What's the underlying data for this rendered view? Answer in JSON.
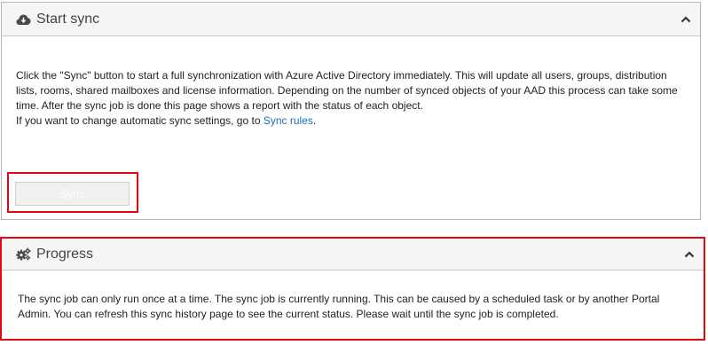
{
  "sync_panel": {
    "title": "Start sync",
    "icon": "cloud-download-icon",
    "paragraph_main": "Click the \"Sync\" button to start a full synchronization with Azure Active Directory immediately. This will update all users, groups, distribution lists, rooms, shared mailboxes and license information. Depending on the number of synced objects of your AAD this process can take some time. After the sync job is done this page shows a report with the status of each object.",
    "paragraph_settings_prefix": "If you want to change automatic sync settings, go to ",
    "sync_rules_link": "Sync rules",
    "paragraph_settings_suffix": ".",
    "sync_button_label": "Sync",
    "sync_button_disabled": true
  },
  "progress_panel": {
    "title": "Progress",
    "icon": "gears-icon",
    "message": "The sync job can only run once at a time. The sync job is currently running. This can be caused by a scheduled task or by another Portal Admin. You can refresh this sync history page to see the current status. Please wait until the sync job is completed."
  },
  "colors": {
    "highlight": "#e30613",
    "link": "#1a6fb5",
    "header_bg": "#f5f5f5"
  }
}
